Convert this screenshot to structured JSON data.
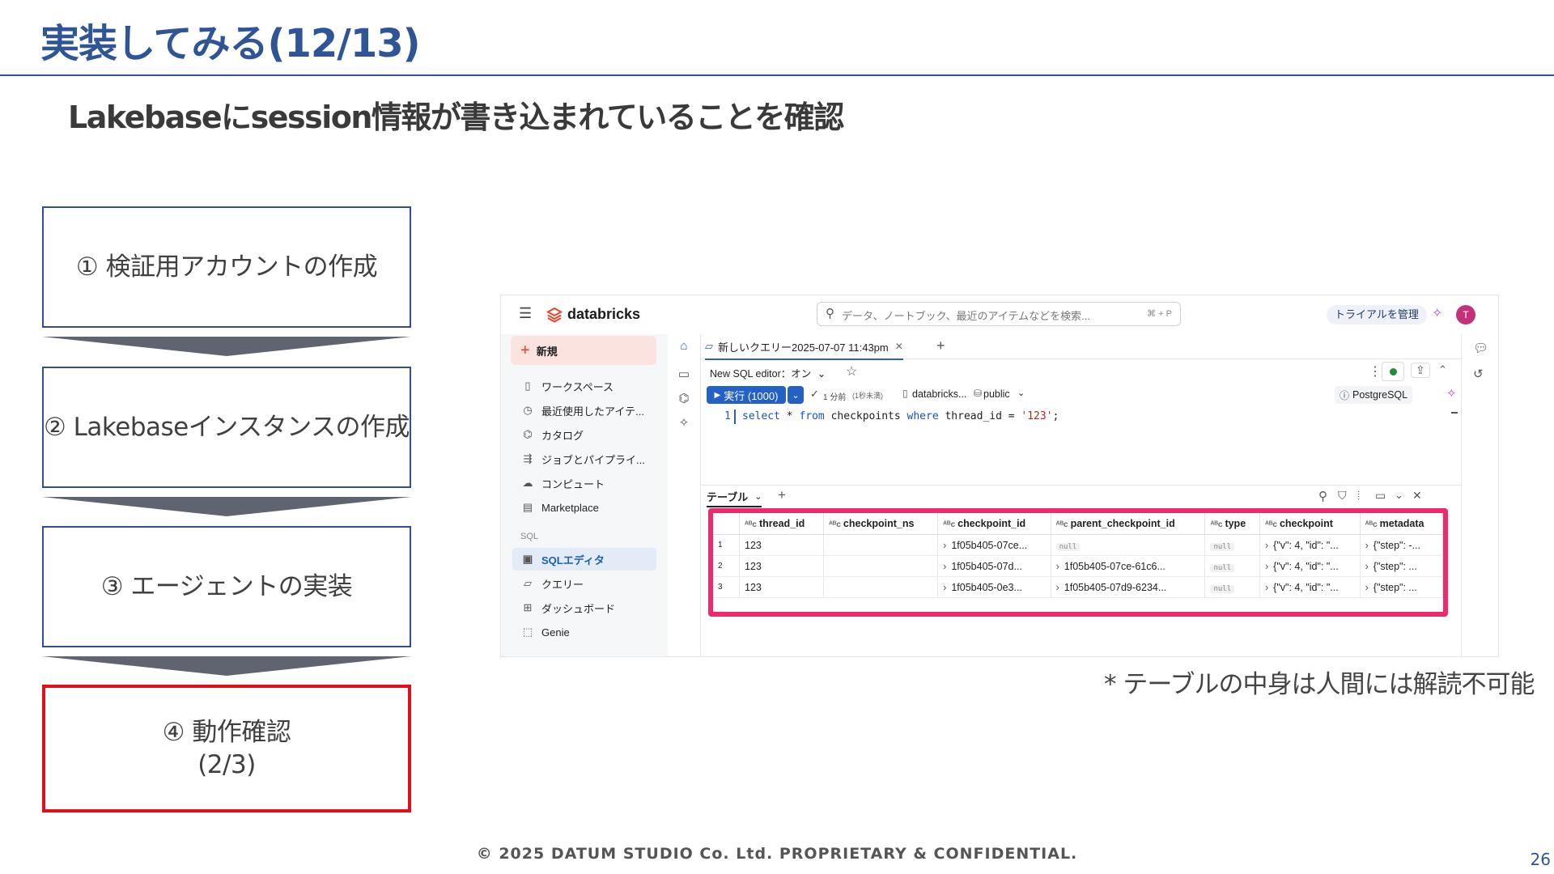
{
  "slide": {
    "title": "実装してみる(12/13)",
    "subtitle": "Lakebaseにsession情報が書き込まれていることを確認",
    "steps": [
      {
        "label": "① 検証用アカウントの作成"
      },
      {
        "label": "② Lakebaseインスタンスの作成"
      },
      {
        "label": "③ エージェントの実装"
      },
      {
        "label_line1": "④ 動作確認",
        "label_line2": "(2/3)"
      }
    ],
    "note": "* テーブルの中身は人間には解読不可能",
    "footer": "© 2025 DATUM STUDIO Co. Ltd. PROPRIETARY & CONFIDENTIAL.",
    "page_number": "26",
    "colors": {
      "title": "#2f5597",
      "current_step_border": "#e0101a",
      "highlight": "#ef2a6a"
    }
  },
  "app": {
    "logo": "databricks",
    "search_placeholder": "データ、ノートブック、最近のアイテムなどを検索...",
    "search_shortcut": "⌘ + P",
    "trial_button": "トライアルを管理",
    "avatar_letter": "T",
    "new_button": "新規",
    "sidebar": {
      "items": [
        {
          "icon": "folder-icon",
          "label": "ワークスペース"
        },
        {
          "icon": "clock-icon",
          "label": "最近使用したアイテ..."
        },
        {
          "icon": "catalog-icon",
          "label": "カタログ"
        },
        {
          "icon": "workflow-icon",
          "label": "ジョブとパイプライ..."
        },
        {
          "icon": "cloud-icon",
          "label": "コンピュート"
        },
        {
          "icon": "store-icon",
          "label": "Marketplace"
        }
      ],
      "section_label": "SQL",
      "sql_items": [
        {
          "icon": "sql-editor-icon",
          "label": "SQLエディタ",
          "active": true
        },
        {
          "icon": "query-icon",
          "label": "クエリー"
        },
        {
          "icon": "dashboard-icon",
          "label": "ダッシュボード"
        },
        {
          "icon": "genie-icon",
          "label": "Genie"
        }
      ]
    },
    "tab_label": "新しいクエリー2025-07-07 11:43pm",
    "editor_mode": "New SQL editor：オン",
    "run_button": "実行 (1000)",
    "run_status": "1 分前",
    "run_duration": "(1秒未満)",
    "catalog": "databricks...",
    "schema": "public",
    "engine_label": "PostgreSQL",
    "code": {
      "line_number": "1",
      "kw_select": "select",
      "star": " * ",
      "kw_from": "from",
      "table": " checkpoints ",
      "kw_where": "where",
      "cond": " thread_id = ",
      "value": "'123'",
      "end": ";"
    },
    "results_tab": "テーブル",
    "results": {
      "columns": [
        "thread_id",
        "checkpoint_ns",
        "checkpoint_id",
        "parent_checkpoint_id",
        "type",
        "checkpoint",
        "metadata"
      ],
      "rows": [
        {
          "n": "1",
          "thread_id": "123",
          "checkpoint_ns": "",
          "checkpoint_id": "1f05b405-07ce...",
          "parent_checkpoint_id": "null",
          "type": "null",
          "checkpoint": "{\"v\": 4, \"id\": \"...",
          "metadata": "{\"step\": -..."
        },
        {
          "n": "2",
          "thread_id": "123",
          "checkpoint_ns": "",
          "checkpoint_id": "1f05b405-07d...",
          "parent_checkpoint_id": "1f05b405-07ce-61c6...",
          "type": "null",
          "checkpoint": "{\"v\": 4, \"id\": \"...",
          "metadata": "{\"step\": ..."
        },
        {
          "n": "3",
          "thread_id": "123",
          "checkpoint_ns": "",
          "checkpoint_id": "1f05b405-0e3...",
          "parent_checkpoint_id": "1f05b405-07d9-6234...",
          "type": "null",
          "checkpoint": "{\"v\": 4, \"id\": \"...",
          "metadata": "{\"step\": ..."
        }
      ]
    }
  }
}
